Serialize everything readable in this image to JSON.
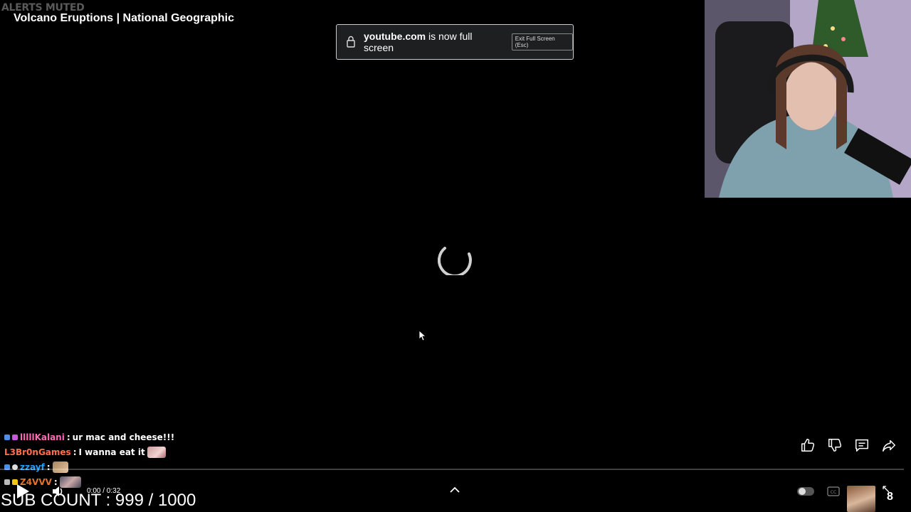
{
  "overlay": {
    "alerts_muted": "ALERTS MUTED",
    "sub_count": "SUB COUNT : 999 / 1000",
    "corner_number": "8"
  },
  "video": {
    "title": "Volcano Eruptions | National Geographic",
    "time": "0:00 / 0:32",
    "progress": 0,
    "loading": true
  },
  "fullscreen_notice": {
    "domain": "youtube.com",
    "message": "is now full screen",
    "exit_label": "Exit Full Screen (Esc)"
  },
  "chat": [
    {
      "user": "lllllKalani",
      "user_color": "#ff69b4",
      "message": "ur mac and cheese!!!",
      "emote": false
    },
    {
      "user": "L3Br0nGames",
      "user_color": "#ff6e4a",
      "message": "I wanna eat it",
      "emote": true
    },
    {
      "user": "zzayf",
      "user_color": "#1f9fff",
      "message": "",
      "emote": true
    },
    {
      "user": "Z4VVV",
      "user_color": "#e2742b",
      "message": "",
      "emote": true
    }
  ],
  "icons": {
    "lock": "lock-icon",
    "like": "thumbs-up-icon",
    "dislike": "thumbs-down-icon",
    "comments": "comment-icon",
    "share": "share-icon",
    "play": "play-icon",
    "volume": "volume-icon",
    "expand": "chevron-up-icon",
    "captions": "cc-icon",
    "fullscreen": "fullscreen-icon"
  }
}
